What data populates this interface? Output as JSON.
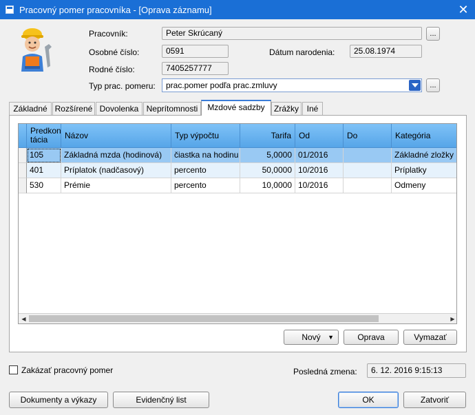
{
  "window": {
    "title": "Pracovný pomer pracovníka - [Oprava záznamu]",
    "close_glyph": "✕"
  },
  "header": {
    "pracovnik_label": "Pracovník:",
    "pracovnik_value": "Peter Skrúcaný",
    "osobne_label": "Osobné číslo:",
    "osobne_value": "0591",
    "datum_label": "Dátum narodenia:",
    "datum_value": "25.08.1974",
    "rodne_label": "Rodné číslo:",
    "rodne_value": "7405257777",
    "typ_label": "Typ prac. pomeru:",
    "typ_value": "prac.pomer podľa prac.zmluvy",
    "ellipsis": "...",
    "avatar_icon": "worker-helmet-icon"
  },
  "tabs": [
    {
      "label": "Základné"
    },
    {
      "label": "Rozšírené"
    },
    {
      "label": "Dovolenka"
    },
    {
      "label": "Neprítomnosti"
    },
    {
      "label": "Mzdové sadzby"
    },
    {
      "label": "Zrážky"
    },
    {
      "label": "Iné"
    }
  ],
  "active_tab": "Mzdové sadzby",
  "grid": {
    "columns": [
      "Predkon tácia",
      "Názov",
      "Typ výpočtu",
      "Tarifa",
      "Od",
      "Do",
      "Kategória"
    ],
    "rows": [
      {
        "code": "105",
        "name": "Základná mzda (hodinová)",
        "type": "čiastka na hodinu",
        "tarifa": "5,0000",
        "od": "01/2016",
        "do": "",
        "kategoria": "Základné zložky"
      },
      {
        "code": "401",
        "name": "Príplatok (nadčasový)",
        "type": "percento",
        "tarifa": "50,0000",
        "od": "10/2016",
        "do": "",
        "kategoria": "Príplatky"
      },
      {
        "code": "530",
        "name": "Prémie",
        "type": "percento",
        "tarifa": "10,0000",
        "od": "10/2016",
        "do": "",
        "kategoria": "Odmeny"
      }
    ],
    "scroll_left": "◀",
    "scroll_right": "▶"
  },
  "grid_buttons": {
    "new": "Nový",
    "edit": "Oprava",
    "delete": "Vymazať",
    "dropdown_glyph": "▼"
  },
  "footer": {
    "forbid_label": "Zakázať pracovný pomer",
    "last_change_label": "Posledná zmena:",
    "last_change_value": "6. 12. 2016 9:15:13",
    "documents": "Dokumenty a výkazy",
    "register": "Evidenčný list",
    "ok": "OK",
    "close": "Zatvoriť"
  },
  "colors": {
    "titlebar": "#1a6fd6",
    "grid_header": "#6ab3f0",
    "selected_row": "#99c9f3"
  }
}
